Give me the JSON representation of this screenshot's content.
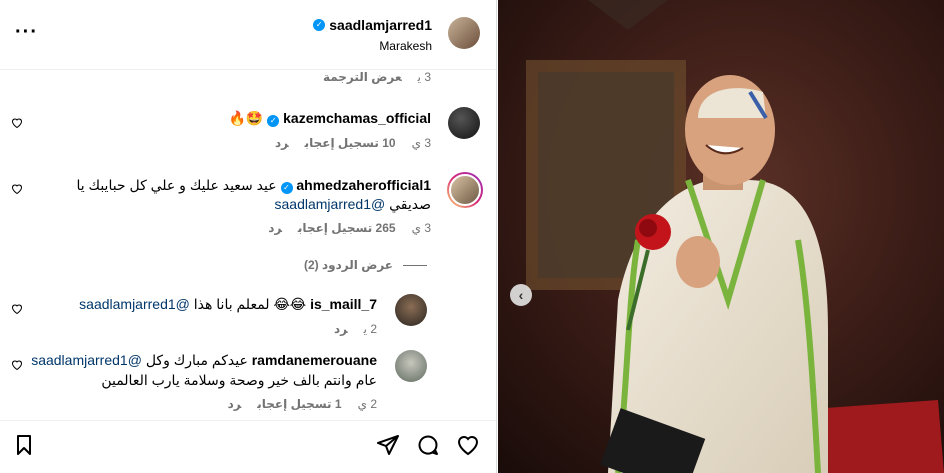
{
  "post": {
    "username": "saadlamjarred1",
    "location": "Marakesh"
  },
  "comments": {
    "top_meta": {
      "time": "3 ي",
      "see_translation": "عرض الترجمة"
    },
    "c1": {
      "username": "kazemchamas_official",
      "text": "🤩🔥",
      "time": "3 ي",
      "likes": "10 تسجيل إعجاب",
      "reply": "رد"
    },
    "c2": {
      "username": "ahmedzaherofficial1",
      "text_line1": "عيد سعيد عليك و علي كل حبايبك يا",
      "text_line2": "صديقي",
      "mention": "@saadlamjarred1",
      "time": "3 ي",
      "likes": "265 تسجيل إعجاب",
      "reply": "رد"
    },
    "view_replies": "عرض الردود (2)",
    "r1": {
      "username": "is_maill_7",
      "text": "😂😂 لمعلم بانا هذا",
      "mention": "@saadlamjarred1",
      "time": "2 ي",
      "reply": "رد"
    },
    "r2": {
      "username": "ramdanemerouane",
      "text_line1": "عيدكم مبارك وكل",
      "mention": "@saadlamjarred1",
      "text_line2": "عام وانتم بالف خير وصحة وسلامة يارب العالمين",
      "time": "2 ي",
      "likes": "1 تسجيل إعجاب",
      "reply": "رد"
    }
  },
  "icons": {
    "more": "more-horizontal-icon",
    "save": "bookmark-icon",
    "share": "send-icon",
    "comment": "comment-icon",
    "like": "heart-icon",
    "prev": "chevron-left-icon"
  },
  "colors": {
    "verified": "#0095f6",
    "mention": "#00376b",
    "meta": "#737373"
  }
}
